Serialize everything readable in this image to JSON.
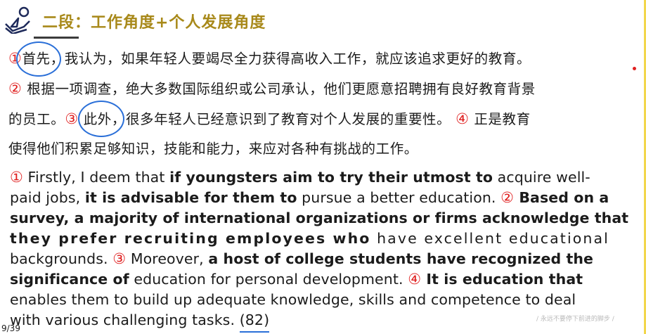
{
  "title": "二段：工作角度+个人发展角度",
  "cn": {
    "line1": {
      "n1": "①",
      "w1": "首先",
      "t1": "，我认为，如果年轻人要竭尽全力获得高收入工作，就应该追求更好的教育。"
    },
    "line2": {
      "n2": "②",
      "t2": "根据一项调查，绝大多数国际组织或公司承认，他们更愿意招聘拥有良好教育背景"
    },
    "line3": {
      "t3a": "的员工。",
      "n3": "③",
      "w3": "此外",
      "t3b": "，很多年轻人已经意识到了教育对个人发展的重要性。",
      "n4": "④",
      "t3c": "正是教育"
    },
    "line4": {
      "t4": "使得他们积累足够知识，技能和能力，来应对各种有挑战的工作。"
    }
  },
  "en": {
    "l1": {
      "n1": "①",
      "a": " Firstly, I deem that ",
      "b": "if youngsters aim to try their utmost to",
      "c": " acquire well-"
    },
    "l2": {
      "a": "paid jobs, ",
      "b": "it is advisable for them to",
      "c": " pursue a better education. ",
      "n2": "②",
      "d": " Based on a"
    },
    "l3": {
      "a": "survey, a majority of international organizations or firms acknowledge that"
    },
    "l4": {
      "a": "they prefer recruiting employees who",
      "b": " have excellent educational"
    },
    "l5": {
      "a": "backgrounds. ",
      "n3": "③",
      "b": " Moreover, ",
      "c": "a host of college students have recognized the"
    },
    "l6": {
      "a": "significance of",
      "b": " education for personal development. ",
      "n4": "④",
      "c": " It is education that"
    },
    "l7": {
      "a": "enables them to build up adequate knowledge, skills and competence to deal"
    },
    "l8": {
      "a": "with various challenging tasks. ",
      "score": "(82)"
    }
  },
  "page_number": "9/39",
  "watermark": "/ 永远不要停下前进的脚步 /",
  "colors": {
    "title": "#a8891a",
    "number": "#e02020",
    "annotation": "#2a6fd8"
  }
}
